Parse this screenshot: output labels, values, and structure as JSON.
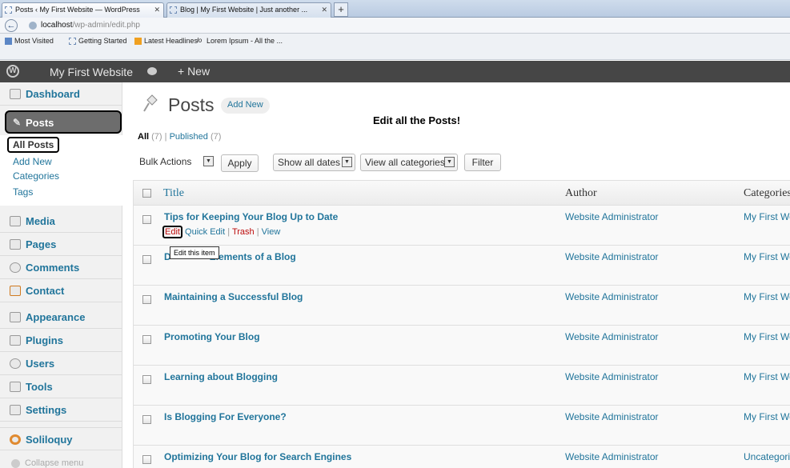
{
  "browser": {
    "tabs": [
      {
        "label": "Posts ‹ My First Website — WordPress"
      },
      {
        "label": "Blog | My First Website | Just another ..."
      }
    ],
    "url_host": "localhost",
    "url_path": "/wp-admin/edit.php",
    "bookmarks": [
      "Most Visited",
      "Getting Started",
      "Latest Headlines",
      "Lorem Ipsum - All the ..."
    ]
  },
  "adminbar": {
    "logo": "W",
    "site_name": "My First Website",
    "new_label": "+ New"
  },
  "sidebar": {
    "items": [
      {
        "label": "Dashboard",
        "icon": "home-icon"
      },
      {
        "label": "Posts",
        "icon": "pin-icon"
      },
      {
        "label": "Media",
        "icon": "media-icon"
      },
      {
        "label": "Pages",
        "icon": "pages-icon"
      },
      {
        "label": "Comments",
        "icon": "comments-icon"
      },
      {
        "label": "Contact",
        "icon": "contact-icon"
      },
      {
        "label": "Appearance",
        "icon": "appearance-icon"
      },
      {
        "label": "Plugins",
        "icon": "plugins-icon"
      },
      {
        "label": "Users",
        "icon": "users-icon"
      },
      {
        "label": "Tools",
        "icon": "tools-icon"
      },
      {
        "label": "Settings",
        "icon": "settings-icon"
      },
      {
        "label": "Soliloquy",
        "icon": "soliloquy-icon"
      }
    ],
    "submenu": [
      "All Posts",
      "Add New",
      "Categories",
      "Tags"
    ],
    "collapse": "Collapse menu"
  },
  "main": {
    "title": "Posts",
    "add_new": "Add New",
    "annotation": "Edit all the Posts!",
    "filter_all": "All",
    "filter_all_count": "(7)",
    "filter_sep": "|",
    "filter_published": "Published",
    "filter_published_count": "(7)",
    "bulk_actions": "Bulk Actions",
    "apply": "Apply",
    "show_dates": "Show all dates",
    "view_categories": "View all categories",
    "filter": "Filter"
  },
  "table": {
    "headers": {
      "title": "Title",
      "author": "Author",
      "categories": "Categories"
    },
    "rows": [
      {
        "title": "Tips for Keeping Your Blog Up to Date",
        "author": "Website Administrator",
        "category": "My First We"
      },
      {
        "title": "Design Elements of a Blog",
        "title_visible": "Elements of a Blog",
        "author": "Website Administrator",
        "category": "My First We"
      },
      {
        "title": "Maintaining a Successful Blog",
        "author": "Website Administrator",
        "category": "My First We"
      },
      {
        "title": "Promoting Your Blog",
        "author": "Website Administrator",
        "category": "My First We"
      },
      {
        "title": "Learning about Blogging",
        "author": "Website Administrator",
        "category": "My First We"
      },
      {
        "title": "Is Blogging For Everyone?",
        "author": "Website Administrator",
        "category": "My First We"
      },
      {
        "title": "Optimizing Your Blog for Search Engines",
        "author": "Website Administrator",
        "category": "Uncategoriz"
      }
    ],
    "row_actions": {
      "edit": "Edit",
      "quick_edit": "Quick Edit",
      "trash": "Trash",
      "view": "View",
      "sep": "|"
    },
    "tooltip": "Edit this item"
  }
}
